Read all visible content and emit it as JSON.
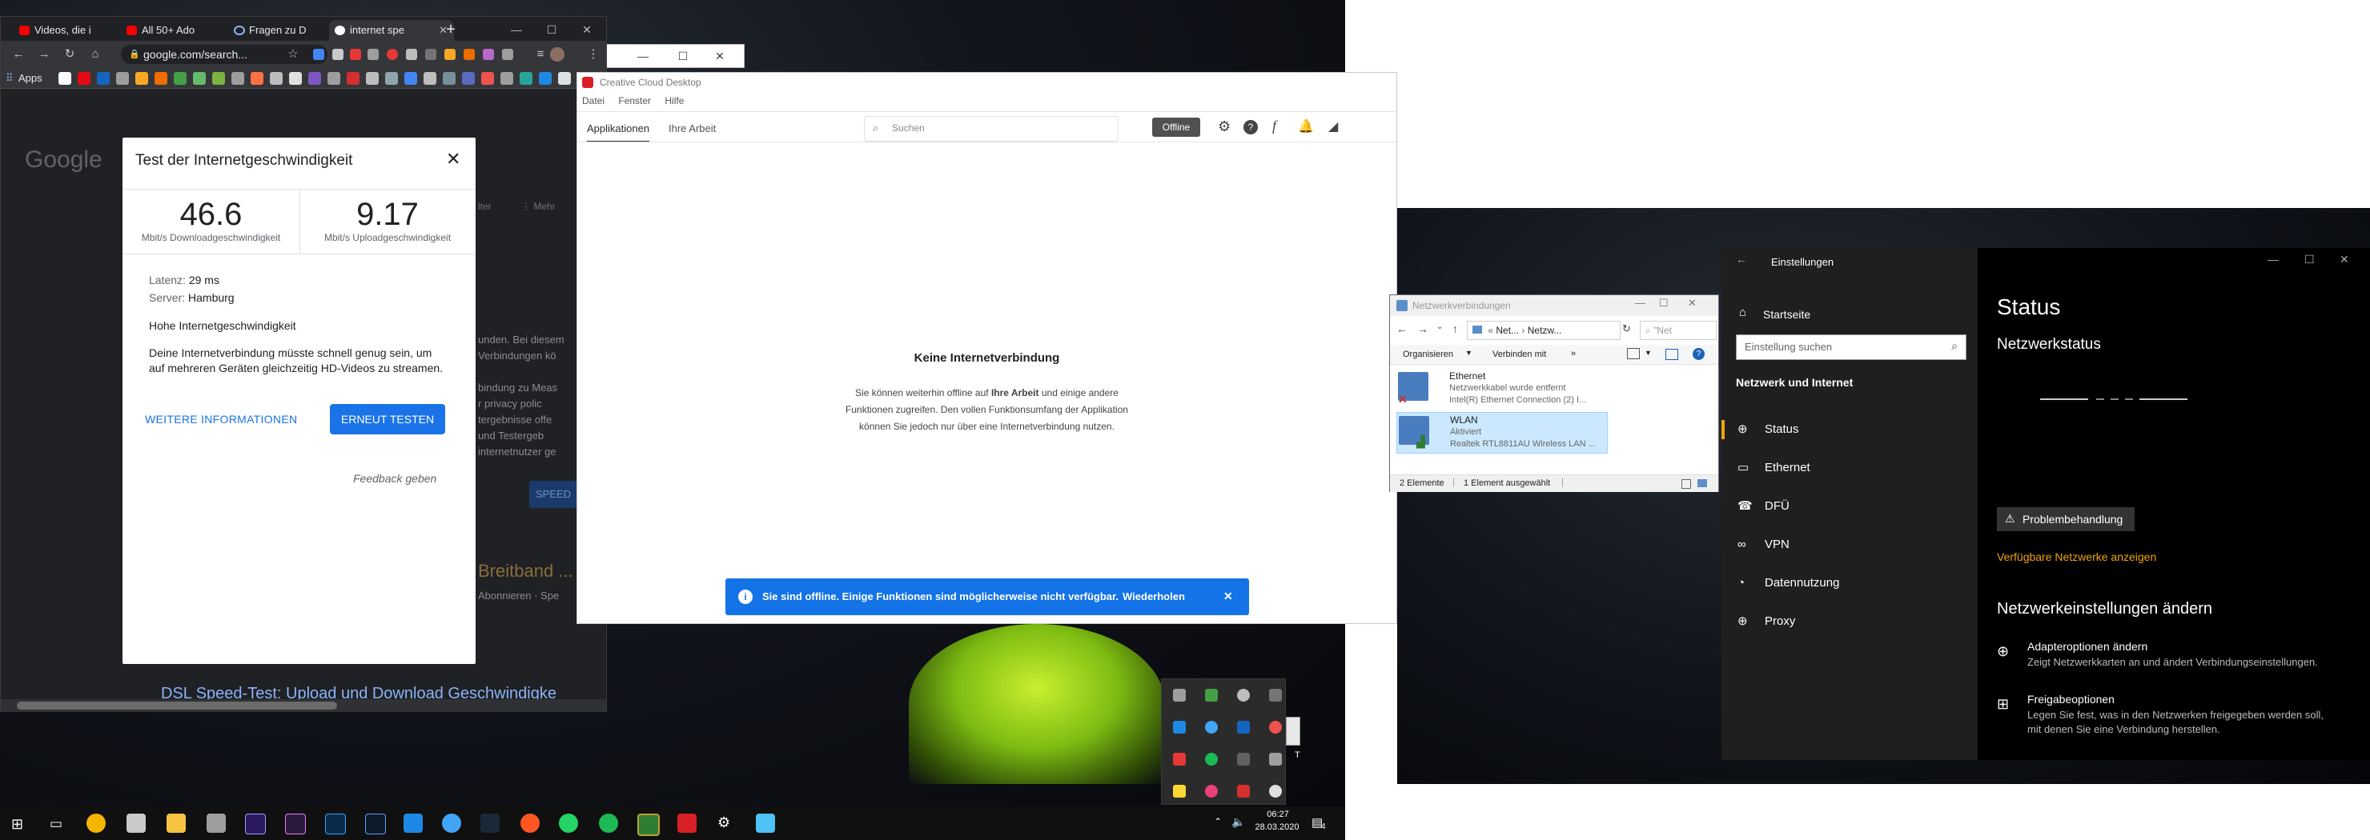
{
  "chrome": {
    "tabs": [
      {
        "label": "Videos, die i"
      },
      {
        "label": "All 50+ Ado"
      },
      {
        "label": "Fragen zu D"
      },
      {
        "label": "internet spe"
      }
    ],
    "new_tab": "+",
    "address": "google.com/search...",
    "bookmarks_apps": "Apps",
    "google_logo": "Google",
    "bg_snippets": {
      "filter_tools": "lter",
      "more": "⋮ Mehr",
      "para1": "unden. Bei diesem",
      "para2": "Verbindungen kö",
      "para3": "bindung zu Meas",
      "para4": "r privacy polic",
      "para5": "tergebnisse offe",
      "para6": "und Testergeb",
      "para7": "internetnutzer ge",
      "speed_btn": "SPEED",
      "broadband": "Breitband ...",
      "abonnieren": "Abonnieren · Spe",
      "dsl": "DSL Speed-Test: Upload und Download Geschwindigke"
    }
  },
  "speedtest": {
    "title": "Test der Internetgeschwindigkeit",
    "close": "✕",
    "download_value": "46.6",
    "download_label": "Mbit/s Downloadgeschwindigkeit",
    "upload_value": "9.17",
    "upload_label": "Mbit/s Uploadgeschwindigkeit",
    "latency_label": "Latenz:",
    "latency_value": "29 ms",
    "server_label": "Server:",
    "server_value": "Hamburg",
    "summary": "Hohe Internetgeschwindigkeit",
    "description": "Deine Internetverbindung müsste schnell genug sein, um auf mehreren Geräten gleichzeitig HD-Videos zu streamen.",
    "more_info": "WEITERE INFORMATIONEN",
    "retest": "ERNEUT TESTEN",
    "feedback": "Feedback geben"
  },
  "creative_cloud": {
    "title": "Creative Cloud Desktop",
    "menu": [
      "Datei",
      "Fenster",
      "Hilfe"
    ],
    "tabs": [
      "Applikationen",
      "Ihre Arbeit"
    ],
    "search_placeholder": "Suchen",
    "offline_badge": "Offline",
    "heading": "Keine Internetverbindung",
    "msg_line1_pre": "Sie können weiterhin offline auf",
    "msg_line1_bold": "Ihre Arbeit",
    "msg_line1_post": "und einige andere",
    "msg_line2": "Funktionen zugreifen. Den vollen Funktionsumfang der Applikation",
    "msg_line3": "können Sie jedoch nur über eine Internetverbindung nutzen.",
    "banner_text": "Sie sind offline. Einige Funktionen sind möglicherweise nicht verfügbar.",
    "banner_retry": "Wiederholen",
    "banner_close": "✕"
  },
  "netzwerk": {
    "title": "Netzwerkverbindungen",
    "path_1": "Net...",
    "path_2": "Netzw...",
    "search_placeholder": "\"Net",
    "organize": "Organisieren",
    "connect_with": "Verbinden mit",
    "more": "»",
    "items": [
      {
        "name": "Ethernet",
        "status": "Netzwerkkabel wurde entfernt",
        "device": "Intel(R) Ethernet Connection (2) I..."
      },
      {
        "name": "WLAN",
        "status": "Aktiviert",
        "device": "Realtek RTL8811AU Wireless LAN ..."
      }
    ],
    "status_count": "2 Elemente",
    "status_selected": "1 Element ausgewählt"
  },
  "settings": {
    "window_title": "Einstellungen",
    "home": "Startseite",
    "search_placeholder": "Einstellung suchen",
    "section": "Netzwerk und Internet",
    "nav": [
      {
        "label": "Status"
      },
      {
        "label": "Ethernet"
      },
      {
        "label": "DFÜ"
      },
      {
        "label": "VPN"
      },
      {
        "label": "Datennutzung"
      },
      {
        "label": "Proxy"
      }
    ],
    "page_title": "Status",
    "subtitle": "Netzwerkstatus",
    "troubleshoot": "Problembehandlung",
    "show_networks": "Verfügbare Netzwerke anzeigen",
    "change_heading": "Netzwerkeinstellungen ändern",
    "adapter_title": "Adapteroptionen ändern",
    "adapter_desc": "Zeigt Netzwerkkarten an und ändert Verbindungseinstellungen.",
    "sharing_title": "Freigabeoptionen",
    "sharing_desc1": "Legen Sie fest, was in den Netzwerken freigegeben werden soll,",
    "sharing_desc2": "mit denen Sie eine Verbindung herstellen."
  },
  "taskbar": {
    "time": "06:27",
    "date": "28.03.2020",
    "notifications": "4",
    "file_letter": "T"
  }
}
